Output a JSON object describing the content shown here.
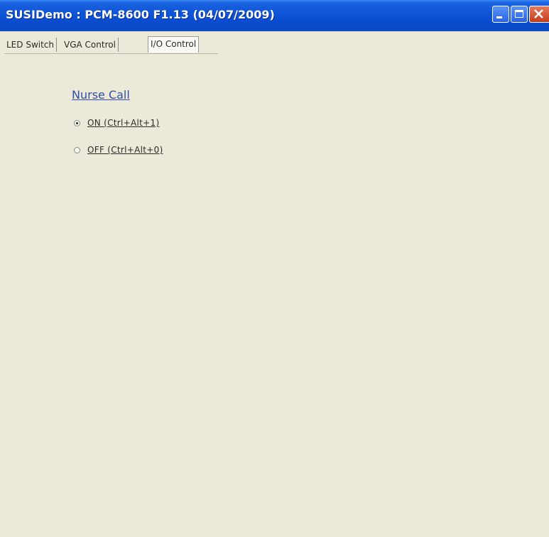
{
  "window": {
    "title": "SUSIDemo : PCM-8600 F1.13 (04/07/2009)"
  },
  "tabs": [
    {
      "label": "LED Switch"
    },
    {
      "label": "VGA Control"
    },
    {
      "label": "I/O Control",
      "selected": true
    }
  ],
  "group": {
    "label": "Nurse Call",
    "options": [
      {
        "label": "ON  (Ctrl+Alt+1)",
        "checked": true
      },
      {
        "label": "OFF (Ctrl+Alt+0)",
        "checked": false
      }
    ]
  },
  "colors": {
    "titlebar": "#0f55d8",
    "client_background": "#ece9d8",
    "group_label": "#2f4fa8",
    "close_button": "#d6512e"
  }
}
